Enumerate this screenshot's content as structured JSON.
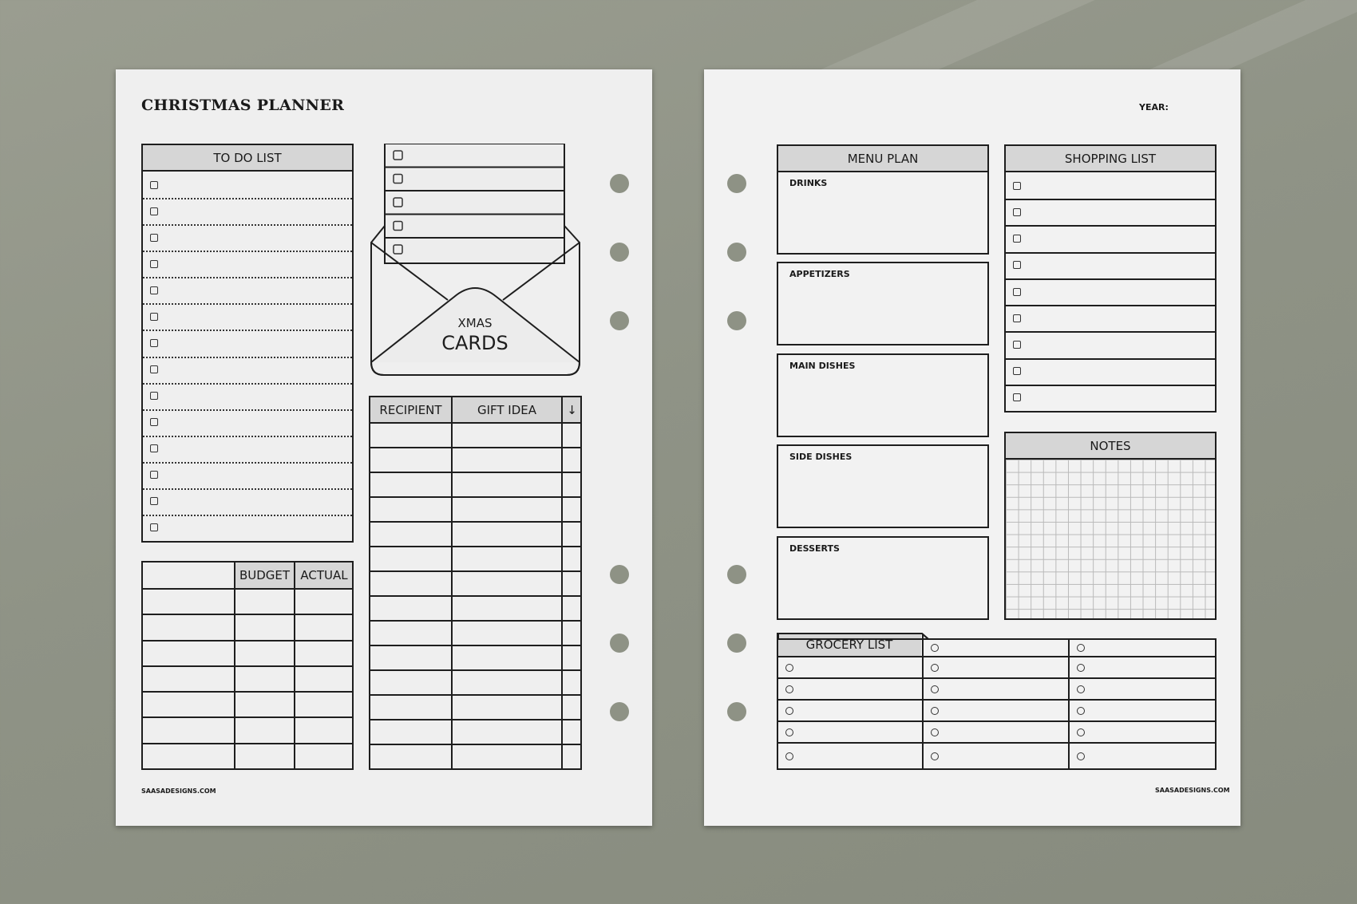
{
  "left_page": {
    "title": "CHRISTMAS PLANNER",
    "todo": {
      "header": "TO DO LIST",
      "rows": 14
    },
    "xmas_cards": {
      "line1": "XMAS",
      "line2": "CARDS",
      "rows": 5
    },
    "budget": {
      "headers": [
        "",
        "BUDGET",
        "ACTUAL"
      ],
      "rows": 7
    },
    "gifts": {
      "headers": [
        "RECIPIENT",
        "GIFT IDEA",
        "↓"
      ],
      "rows": 14
    },
    "footer": "SAASADESIGNS.COM"
  },
  "right_page": {
    "year_label": "YEAR:",
    "menu_plan": {
      "header": "MENU PLAN",
      "sections": [
        "DRINKS",
        "APPETIZERS",
        "MAIN DISHES",
        "SIDE DISHES",
        "DESSERTS"
      ]
    },
    "shopping": {
      "header": "SHOPPING LIST",
      "rows": 9
    },
    "notes": {
      "header": "NOTES"
    },
    "grocery": {
      "header": "GROCERY LIST",
      "columns": 3,
      "rows": 6
    },
    "footer": "SAASADESIGNS.COM"
  },
  "colors": {
    "background": "#8f9386",
    "paper": "#efefef",
    "header_fill": "#d6d6d6",
    "ink": "#1e1e1e"
  }
}
